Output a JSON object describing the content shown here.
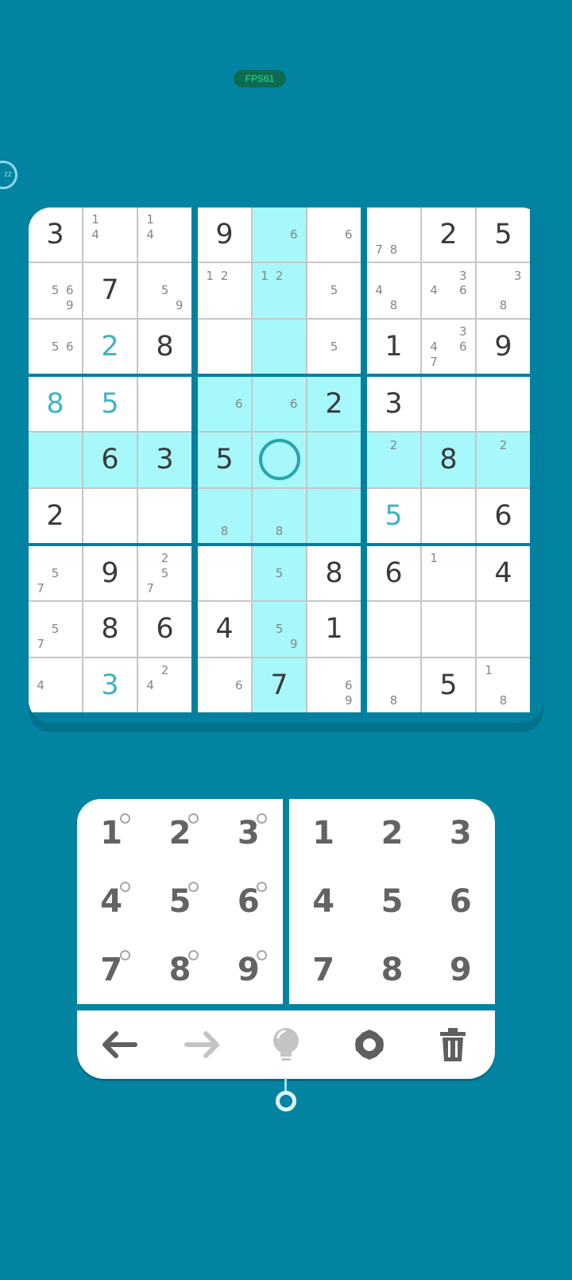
{
  "fps_badge": "FPS61",
  "zz_badge": "zz",
  "colors": {
    "background": "#0283a2",
    "highlight": "#a6f8fb",
    "user_digit": "#3fb4c1",
    "given_digit": "#3a3a3a",
    "note": "#858585",
    "selection_ring": "#2aa3ad"
  },
  "board": {
    "selected": [
      4,
      4
    ],
    "highlight_row": 4,
    "highlight_col": 4,
    "cells": [
      [
        {
          "v": "3",
          "t": "given"
        },
        {
          "n": [
            1,
            4
          ]
        },
        {
          "n": [
            1,
            4
          ]
        },
        {
          "v": "9",
          "t": "given"
        },
        {
          "n": [
            6
          ]
        },
        {
          "n": [
            6
          ]
        },
        {
          "n": [
            7,
            8
          ]
        },
        {
          "v": "2",
          "t": "given"
        },
        {
          "v": "5",
          "t": "given"
        }
      ],
      [
        {
          "n": [
            5,
            6,
            9
          ]
        },
        {
          "v": "7",
          "t": "given"
        },
        {
          "n": [
            5,
            9
          ]
        },
        {
          "n": [
            1,
            2
          ]
        },
        {
          "n": [
            1,
            2
          ]
        },
        {
          "n": [
            5
          ]
        },
        {
          "n": [
            4,
            8
          ]
        },
        {
          "n": [
            3,
            4,
            6
          ]
        },
        {
          "n": [
            3,
            8
          ]
        }
      ],
      [
        {
          "n": [
            5,
            6
          ]
        },
        {
          "v": "2",
          "t": "user"
        },
        {
          "v": "8",
          "t": "given"
        },
        {},
        {},
        {
          "n": [
            5
          ]
        },
        {
          "v": "1",
          "t": "given"
        },
        {
          "n": [
            3,
            4,
            6,
            7
          ]
        },
        {
          "v": "9",
          "t": "given"
        }
      ],
      [
        {
          "v": "8",
          "t": "user"
        },
        {
          "v": "5",
          "t": "user"
        },
        {},
        {
          "n": [
            6
          ]
        },
        {
          "n": [
            6
          ]
        },
        {
          "v": "2",
          "t": "given"
        },
        {
          "v": "3",
          "t": "given"
        },
        {},
        {}
      ],
      [
        {},
        {
          "v": "6",
          "t": "given"
        },
        {
          "v": "3",
          "t": "given"
        },
        {
          "v": "5",
          "t": "given"
        },
        {},
        {},
        {
          "n": [
            2
          ]
        },
        {
          "v": "8",
          "t": "given"
        },
        {
          "n": [
            2
          ]
        }
      ],
      [
        {
          "v": "2",
          "t": "given"
        },
        {},
        {},
        {
          "n": [
            8
          ]
        },
        {
          "n": [
            8
          ]
        },
        {},
        {
          "v": "5",
          "t": "user"
        },
        {},
        {
          "v": "6",
          "t": "given"
        }
      ],
      [
        {
          "n": [
            5,
            7
          ]
        },
        {
          "v": "9",
          "t": "given"
        },
        {
          "n": [
            2,
            5,
            7
          ]
        },
        {},
        {
          "n": [
            5
          ]
        },
        {
          "v": "8",
          "t": "given"
        },
        {
          "v": "6",
          "t": "given"
        },
        {
          "n": [
            1
          ]
        },
        {
          "v": "4",
          "t": "given"
        }
      ],
      [
        {
          "n": [
            5,
            7
          ]
        },
        {
          "v": "8",
          "t": "given"
        },
        {
          "v": "6",
          "t": "given"
        },
        {
          "v": "4",
          "t": "given"
        },
        {
          "n": [
            5,
            9
          ]
        },
        {
          "v": "1",
          "t": "given"
        },
        {},
        {},
        {}
      ],
      [
        {
          "n": [
            4
          ]
        },
        {
          "v": "3",
          "t": "user"
        },
        {
          "n": [
            2,
            4
          ]
        },
        {
          "n": [
            6
          ]
        },
        {
          "v": "7",
          "t": "given"
        },
        {
          "n": [
            6,
            9
          ]
        },
        {
          "n": [
            8
          ]
        },
        {
          "v": "5",
          "t": "given"
        },
        {
          "n": [
            1,
            8
          ]
        }
      ]
    ]
  },
  "notes_pad": {
    "keys": [
      "1",
      "2",
      "3",
      "4",
      "5",
      "6",
      "7",
      "8",
      "9"
    ]
  },
  "number_pad": {
    "keys": [
      "1",
      "2",
      "3",
      "4",
      "5",
      "6",
      "7",
      "8",
      "9"
    ]
  },
  "toolbar": [
    {
      "name": "undo-button",
      "icon": "arrow-left-icon",
      "color": "#5f5f5f"
    },
    {
      "name": "redo-button",
      "icon": "arrow-right-icon",
      "color": "#c4c4c4"
    },
    {
      "name": "hint-button",
      "icon": "lightbulb-icon",
      "color": "#c4c4c4"
    },
    {
      "name": "settings-button",
      "icon": "gear-icon",
      "color": "#5f5f5f"
    },
    {
      "name": "delete-button",
      "icon": "trash-icon",
      "color": "#5f5f5f"
    }
  ]
}
